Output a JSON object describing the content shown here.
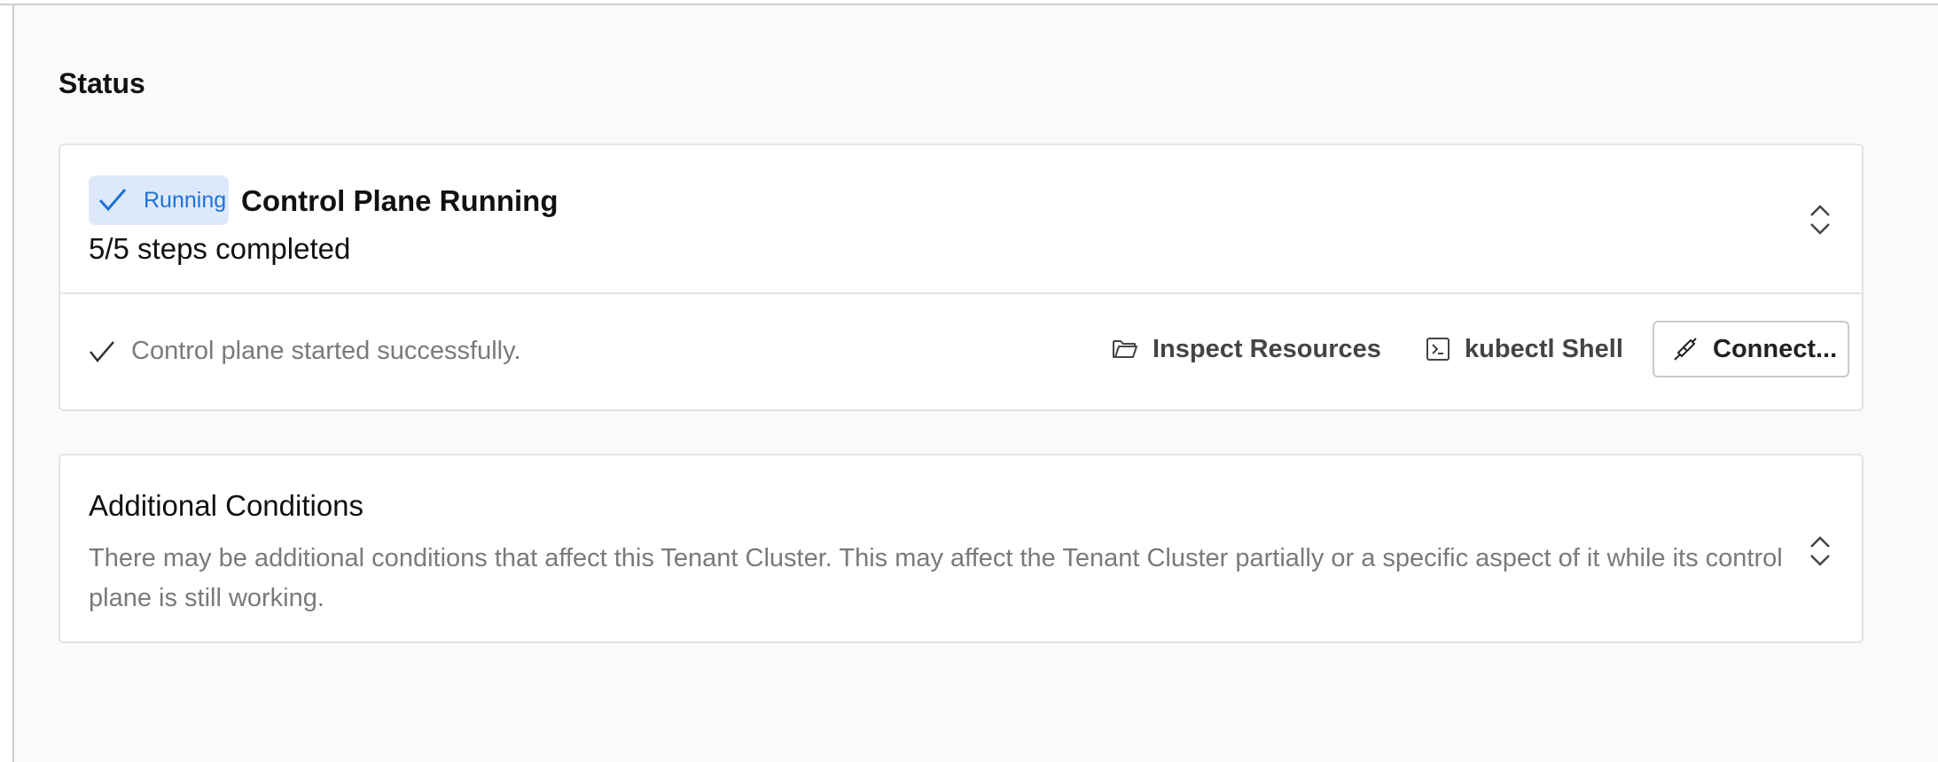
{
  "status": {
    "section_title": "Status",
    "badge_label": "Running",
    "title": "Control Plane Running",
    "steps": "5/5 steps completed",
    "message": "Control plane started successfully.",
    "actions": {
      "inspect_label": "Inspect Resources",
      "shell_label": "kubectl Shell",
      "connect_label": "Connect..."
    },
    "badge_color": "#1d72d6",
    "badge_bg": "#dde9fb"
  },
  "conditions": {
    "title": "Additional Conditions",
    "description": "There may be additional conditions that affect this Tenant Cluster. This may affect the Tenant Cluster partially or a specific aspect of it while its control plane is still working."
  },
  "icons": [
    "check-icon",
    "expand-collapse-icon",
    "folder-icon",
    "terminal-icon",
    "plug-icon"
  ]
}
